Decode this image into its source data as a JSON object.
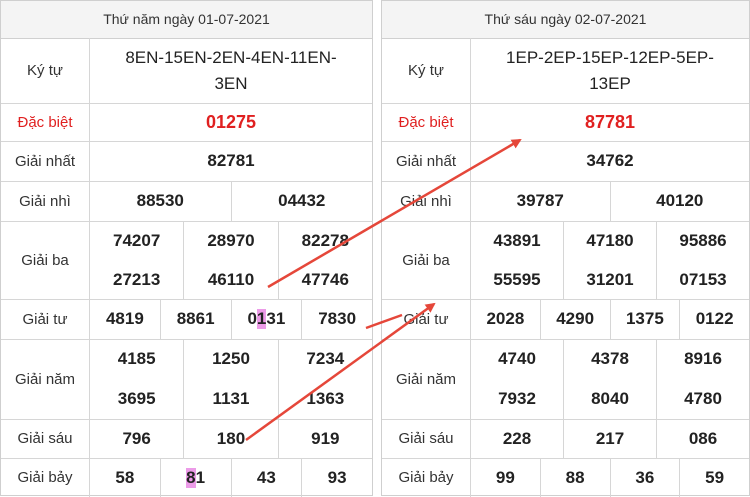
{
  "left": {
    "date": "Thứ năm ngày 01-07-2021",
    "code_line1": "8EN-15EN-2EN-4EN-11EN-",
    "code_line2": "3EN",
    "labels": {
      "code": "Ký tự",
      "db": "Đặc biệt",
      "g1": "Giải nhất",
      "g2": "Giải nhì",
      "g3": "Giải ba",
      "g4": "Giải tư",
      "g5": "Giải năm",
      "g6": "Giải sáu",
      "g7": "Giải bảy"
    },
    "db": "01275",
    "g1": "82781",
    "g2": [
      "88530",
      "04432"
    ],
    "g3": [
      "74207",
      "28970",
      "82278",
      "27213",
      "46110",
      "47746"
    ],
    "g4_a": "4819",
    "g4_b": "8861",
    "g4_c1": "0",
    "g4_c2": "1",
    "g4_c3": "31",
    "g4_d": "7830",
    "g5": [
      "4185",
      "1250",
      "7234",
      "3695",
      "1131",
      "1363"
    ],
    "g6": [
      "796",
      "180",
      "919"
    ],
    "g7_a": "58",
    "g7_b1": "8",
    "g7_b2": "1",
    "g7_c": "43",
    "g7_d": "93"
  },
  "right": {
    "date": "Thứ sáu ngày 02-07-2021",
    "code_line1": "1EP-2EP-15EP-12EP-5EP-",
    "code_line2": "13EP",
    "labels": {
      "code": "Ký tự",
      "db": "Đặc biệt",
      "g1": "Giải nhất",
      "g2": "Giải nhì",
      "g3": "Giải ba",
      "g4": "Giải tư",
      "g5": "Giải năm",
      "g6": "Giải sáu",
      "g7": "Giải bảy"
    },
    "db": "87781",
    "g1": "34762",
    "g2": [
      "39787",
      "40120"
    ],
    "g3": [
      "43891",
      "47180",
      "95886",
      "55595",
      "31201",
      "07153"
    ],
    "g4": [
      "2028",
      "4290",
      "1375",
      "0122"
    ],
    "g5": [
      "4740",
      "4378",
      "8916",
      "7932",
      "8040",
      "4780"
    ],
    "g6": [
      "228",
      "217",
      "086"
    ],
    "g7": [
      "99",
      "88",
      "36",
      "59"
    ]
  },
  "colors": {
    "special": "#e02020",
    "highlight": "#ec9be8",
    "arrow": "#e5473a"
  }
}
